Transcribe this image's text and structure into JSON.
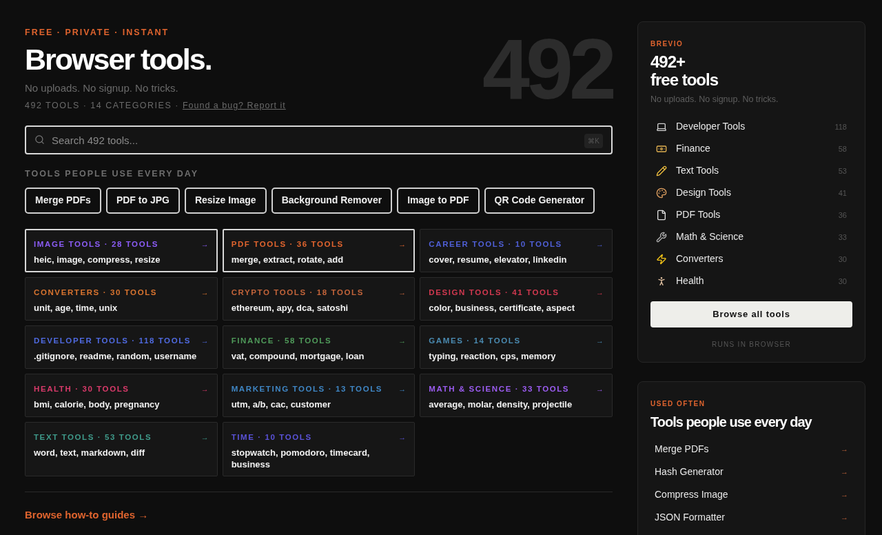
{
  "hero": {
    "eyebrow": "FREE · PRIVATE · INSTANT",
    "title": "Browser tools.",
    "big_count": "492",
    "subtitle": "No uploads. No signup. No tricks.",
    "stats": "492 TOOLS · 14 CATEGORIES ·",
    "bug_link": "Found a bug? Report it"
  },
  "search": {
    "placeholder": "Search 492 tools...",
    "shortcut": "⌘K"
  },
  "popular": {
    "heading": "TOOLS PEOPLE USE EVERY DAY",
    "chips": [
      "Merge PDFs",
      "PDF to JPG",
      "Resize Image",
      "Background Remover",
      "Image to PDF",
      "QR Code Generator"
    ]
  },
  "categories": [
    {
      "title": "IMAGE TOOLS · 28 TOOLS",
      "tags": "heic, image, compress, resize",
      "arrow": "→",
      "color": "#8b5cf6",
      "highlighted": true
    },
    {
      "title": "PDF TOOLS · 36 TOOLS",
      "tags": "merge, extract, rotate, add",
      "arrow": "→",
      "color": "#e0642e",
      "highlighted": true
    },
    {
      "title": "CAREER TOOLS · 10 TOOLS",
      "tags": "cover, resume, elevator, linkedin",
      "arrow": "→",
      "color": "#4f5fd6",
      "highlighted": false
    },
    {
      "title": "CONVERTERS · 30 TOOLS",
      "tags": "unit, age, time, unix",
      "arrow": "→",
      "color": "#d9742f",
      "highlighted": false
    },
    {
      "title": "CRYPTO TOOLS · 18 TOOLS",
      "tags": "ethereum, apy, dca, satoshi",
      "arrow": "→",
      "color": "#c2643a",
      "highlighted": false
    },
    {
      "title": "DESIGN TOOLS · 41 TOOLS",
      "tags": "color, business, certificate, aspect",
      "arrow": "→",
      "color": "#d0384f",
      "highlighted": false
    },
    {
      "title": "DEVELOPER TOOLS · 118 TOOLS",
      "tags": ".gitignore, readme, random, username",
      "arrow": "→",
      "color": "#4f6ae0",
      "highlighted": false
    },
    {
      "title": "FINANCE · 58 TOOLS",
      "tags": "vat, compound, mortgage, loan",
      "arrow": "→",
      "color": "#4f9a5a",
      "highlighted": false
    },
    {
      "title": "GAMES · 14 TOOLS",
      "tags": "typing, reaction, cps, memory",
      "arrow": "→",
      "color": "#4a8ab0",
      "highlighted": false
    },
    {
      "title": "HEALTH · 30 TOOLS",
      "tags": "bmi, calorie, body, pregnancy",
      "arrow": "→",
      "color": "#d93a6a",
      "highlighted": false
    },
    {
      "title": "MARKETING TOOLS · 13 TOOLS",
      "tags": "utm, a/b, cac, customer",
      "arrow": "→",
      "color": "#3f86c4",
      "highlighted": false
    },
    {
      "title": "MATH & SCIENCE · 33 TOOLS",
      "tags": "average, molar, density, projectile",
      "arrow": "→",
      "color": "#9b5cf0",
      "highlighted": false
    },
    {
      "title": "TEXT TOOLS · 53 TOOLS",
      "tags": "word, text, markdown, diff",
      "arrow": "→",
      "color": "#3f9a8a",
      "highlighted": false
    },
    {
      "title": "TIME · 10 TOOLS",
      "tags": "stopwatch, pomodoro, timecard, business",
      "arrow": "→",
      "color": "#5a52d8",
      "highlighted": false
    }
  ],
  "guides_link": "Browse how-to guides →",
  "brand_card": {
    "eyebrow": "BREVIO",
    "title_line1": "492+",
    "title_line2": "free tools",
    "subtitle": "No uploads. No signup. No tricks.",
    "items": [
      {
        "kind": "laptop",
        "label": "Developer Tools",
        "count": "118"
      },
      {
        "kind": "money",
        "label": "Finance",
        "count": "58"
      },
      {
        "kind": "pencil",
        "label": "Text Tools",
        "count": "53"
      },
      {
        "kind": "palette",
        "label": "Design Tools",
        "count": "41"
      },
      {
        "kind": "file",
        "label": "PDF Tools",
        "count": "36"
      },
      {
        "kind": "wrench",
        "label": "Math & Science",
        "count": "33"
      },
      {
        "kind": "bolt",
        "label": "Converters",
        "count": "30"
      },
      {
        "kind": "runner",
        "label": "Health",
        "count": "30"
      }
    ],
    "button": "Browse all tools",
    "footnote": "RUNS IN BROWSER"
  },
  "used_often": {
    "eyebrow": "USED OFTEN",
    "title": "Tools people use every day",
    "items": [
      {
        "label": "Merge PDFs",
        "arrow": "→"
      },
      {
        "label": "Hash Generator",
        "arrow": "→"
      },
      {
        "label": "Compress Image",
        "arrow": "→"
      },
      {
        "label": "JSON Formatter",
        "arrow": "→"
      }
    ]
  }
}
